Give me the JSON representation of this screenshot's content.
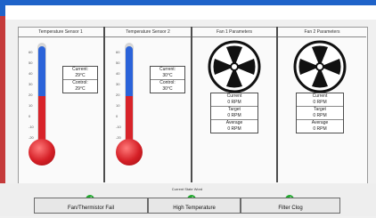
{
  "panels": [
    {
      "title": "Temperature Sensor 1",
      "current_label": "Current:",
      "current_value": "29°C",
      "control_label": "Control:",
      "control_value": "29°C",
      "ticks": [
        "60",
        "50",
        "40",
        "30",
        "20",
        "10",
        "0",
        "-10",
        "-20"
      ]
    },
    {
      "title": "Temperature Sensor 2",
      "current_label": "Current:",
      "current_value": "30°C",
      "control_label": "Control:",
      "control_value": "30°C",
      "ticks": [
        "60",
        "50",
        "40",
        "30",
        "20",
        "10",
        "0",
        "-10",
        "-20"
      ]
    },
    {
      "title": "Fan 1 Parameters",
      "current_label": "Current",
      "current_value": "0 RPM",
      "target_label": "Target",
      "target_value": "0 RPM",
      "average_label": "Average",
      "average_value": "0 RPM"
    },
    {
      "title": "Fan 2 Parameters",
      "current_label": "Current",
      "current_value": "0 RPM",
      "target_label": "Target",
      "target_value": "0 RPM",
      "average_label": "Average",
      "average_value": "0 RPM"
    }
  ],
  "bottom": {
    "state_label": "Current State Word",
    "buttons": [
      {
        "label": "Fan/Thermistor Fail",
        "status": "ok"
      },
      {
        "label": "High Temperature",
        "status": "ok"
      },
      {
        "label": "Filter Clog",
        "status": "ok"
      }
    ]
  },
  "colors": {
    "titlebar": "#1f63c9",
    "thermo_red": "#d8232a",
    "thermo_blue": "#2b63d9",
    "check_green": "#1fa82d"
  }
}
